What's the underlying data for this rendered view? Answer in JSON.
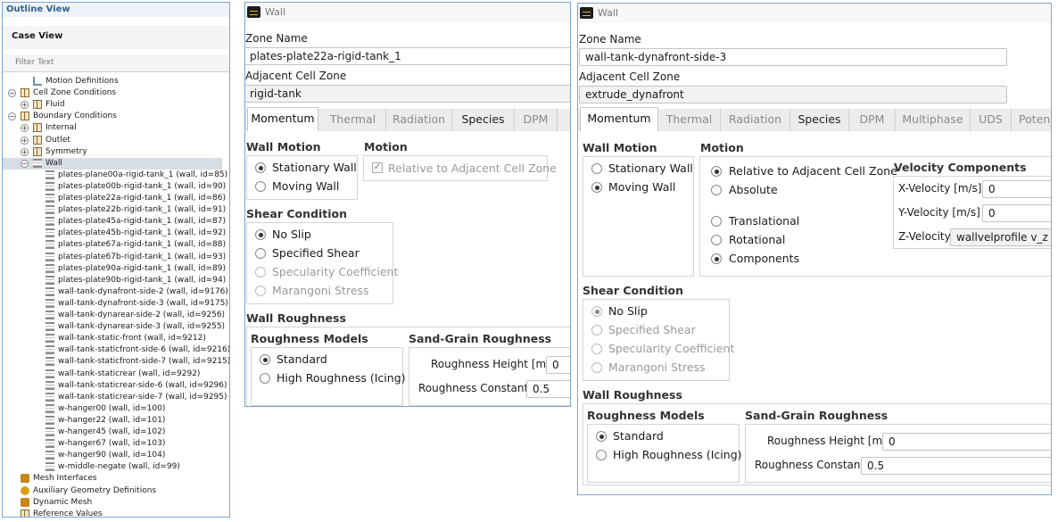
{
  "outline": {
    "title": "Outline View",
    "case_view": "Case View",
    "filter_placeholder": "Filter Text",
    "tree": [
      {
        "label": "Motion Definitions",
        "level": 2,
        "icon": "motion",
        "expander": ""
      },
      {
        "label": "Cell Zone Conditions",
        "level": 1,
        "icon": "grid",
        "expander": "−"
      },
      {
        "label": "Fluid",
        "level": 2,
        "icon": "grid",
        "expander": "+"
      },
      {
        "label": "Boundary Conditions",
        "level": 1,
        "icon": "grid",
        "expander": "−"
      },
      {
        "label": "Internal",
        "level": 2,
        "icon": "grid",
        "expander": "+"
      },
      {
        "label": "Outlet",
        "level": 2,
        "icon": "grid",
        "expander": "+"
      },
      {
        "label": "Symmetry",
        "level": 2,
        "icon": "grid",
        "expander": "+"
      },
      {
        "label": "Wall",
        "level": 2,
        "icon": "wall",
        "expander": "−",
        "selected": true
      },
      {
        "label": "plates-plane00a-rigid-tank_1 (wall, id=85)",
        "level": 3,
        "icon": "wall",
        "expander": ""
      },
      {
        "label": "plates-plate00b-rigid-tank_1 (wall, id=90)",
        "level": 3,
        "icon": "wall",
        "expander": ""
      },
      {
        "label": "plates-plate22a-rigid-tank_1 (wall, id=86)",
        "level": 3,
        "icon": "wall",
        "expander": ""
      },
      {
        "label": "plates-plate22b-rigid-tank_1 (wall, id=91)",
        "level": 3,
        "icon": "wall",
        "expander": ""
      },
      {
        "label": "plates-plate45a-rigid-tank_1 (wall, id=87)",
        "level": 3,
        "icon": "wall",
        "expander": ""
      },
      {
        "label": "plates-plate45b-rigid-tank_1 (wall, id=92)",
        "level": 3,
        "icon": "wall",
        "expander": ""
      },
      {
        "label": "plates-plate67a-rigid-tank_1 (wall, id=88)",
        "level": 3,
        "icon": "wall",
        "expander": ""
      },
      {
        "label": "plates-plate67b-rigid-tank_1 (wall, id=93)",
        "level": 3,
        "icon": "wall",
        "expander": ""
      },
      {
        "label": "plates-plate90a-rigid-tank_1 (wall, id=89)",
        "level": 3,
        "icon": "wall",
        "expander": ""
      },
      {
        "label": "plates-plate90b-rigid-tank_1 (wall, id=94)",
        "level": 3,
        "icon": "wall",
        "expander": ""
      },
      {
        "label": "wall-tank-dynafront-side-2 (wall, id=9176)",
        "level": 3,
        "icon": "wall",
        "expander": ""
      },
      {
        "label": "wall-tank-dynafront-side-3 (wall, id=9175)",
        "level": 3,
        "icon": "wall",
        "expander": ""
      },
      {
        "label": "wall-tank-dynarear-side-2 (wall, id=9256)",
        "level": 3,
        "icon": "wall",
        "expander": ""
      },
      {
        "label": "wall-tank-dynarear-side-3 (wall, id=9255)",
        "level": 3,
        "icon": "wall",
        "expander": ""
      },
      {
        "label": "wall-tank-static-front (wall, id=9212)",
        "level": 3,
        "icon": "wall",
        "expander": ""
      },
      {
        "label": "wall-tank-staticfront-side-6 (wall, id=9216)",
        "level": 3,
        "icon": "wall",
        "expander": ""
      },
      {
        "label": "wall-tank-staticfront-side-7 (wall, id=9215)",
        "level": 3,
        "icon": "wall",
        "expander": ""
      },
      {
        "label": "wall-tank-staticrear (wall, id=9292)",
        "level": 3,
        "icon": "wall",
        "expander": ""
      },
      {
        "label": "wall-tank-staticrear-side-6 (wall, id=9296)",
        "level": 3,
        "icon": "wall",
        "expander": ""
      },
      {
        "label": "wall-tank-staticrear-side-7 (wall, id=9295)",
        "level": 3,
        "icon": "wall",
        "expander": ""
      },
      {
        "label": "w-hanger00 (wall, id=100)",
        "level": 3,
        "icon": "wall",
        "expander": ""
      },
      {
        "label": "w-hanger22 (wall, id=101)",
        "level": 3,
        "icon": "wall",
        "expander": ""
      },
      {
        "label": "w-hanger45 (wall, id=102)",
        "level": 3,
        "icon": "wall",
        "expander": ""
      },
      {
        "label": "w-hanger67 (wall, id=103)",
        "level": 3,
        "icon": "wall",
        "expander": ""
      },
      {
        "label": "w-hanger90 (wall, id=104)",
        "level": 3,
        "icon": "wall",
        "expander": ""
      },
      {
        "label": "w-middle-negate (wall, id=99)",
        "level": 3,
        "icon": "wall",
        "expander": ""
      },
      {
        "label": "Mesh Interfaces",
        "level": 1,
        "icon": "orange",
        "expander": ""
      },
      {
        "label": "Auxiliary Geometry Definitions",
        "level": 1,
        "icon": "gear",
        "expander": ""
      },
      {
        "label": "Dynamic Mesh",
        "level": 1,
        "icon": "orange",
        "expander": ""
      },
      {
        "label": "Reference Values",
        "level": 1,
        "icon": "grid",
        "expander": ""
      }
    ]
  },
  "panel1": {
    "title": "Wall",
    "zone_name_label": "Zone Name",
    "zone_name": "plates-plate22a-rigid-tank_1",
    "adjacent_label": "Adjacent Cell Zone",
    "adjacent": "rigid-tank",
    "tabs": [
      "Momentum",
      "Thermal",
      "Radiation",
      "Species",
      "DPM",
      ""
    ],
    "wall_motion_title": "Wall Motion",
    "stationary": "Stationary Wall",
    "moving": "Moving Wall",
    "motion_title": "Motion",
    "relative": "Relative to Adjacent Cell Zone",
    "shear_title": "Shear Condition",
    "shear": [
      "No Slip",
      "Specified Shear",
      "Specularity Coefficient",
      "Marangoni Stress"
    ],
    "roughness_title": "Wall Roughness",
    "models_title": "Roughness Models",
    "standard": "Standard",
    "high": "High Roughness (Icing)",
    "sand_title": "Sand-Grain Roughness",
    "height_label": "Roughness Height [m]",
    "height_value": "0",
    "constant_label": "Roughness Constant",
    "constant_value": "0.5"
  },
  "panel2": {
    "title": "Wall",
    "zone_name_label": "Zone Name",
    "zone_name": "wall-tank-dynafront-side-3",
    "adjacent_label": "Adjacent Cell Zone",
    "adjacent": "extrude_dynafront",
    "tabs": [
      "Momentum",
      "Thermal",
      "Radiation",
      "Species",
      "DPM",
      "Multiphase",
      "UDS",
      "Poten"
    ],
    "wall_motion_title": "Wall Motion",
    "stationary": "Stationary Wall",
    "moving": "Moving Wall",
    "motion_title": "Motion",
    "relative": "Relative to Adjacent Cell Zone",
    "absolute": "Absolute",
    "translational": "Translational",
    "rotational": "Rotational",
    "components": "Components",
    "velocity_title": "Velocity Components",
    "xvel_label": "X-Velocity [m/s]",
    "xvel": "0",
    "yvel_label": "Y-Velocity [m/s]",
    "yvel": "0",
    "zvel_label": "Z-Velocity",
    "zvel": "wallvelprofile v_z",
    "shear_title": "Shear Condition",
    "shear": [
      "No Slip",
      "Specified Shear",
      "Specularity Coefficient",
      "Marangoni Stress"
    ],
    "roughness_title": "Wall Roughness",
    "models_title": "Roughness Models",
    "standard": "Standard",
    "high": "High Roughness (Icing)",
    "sand_title": "Sand-Grain Roughness",
    "height_label": "Roughness Height [m]",
    "height_value": "0",
    "constant_label": "Roughness Constant",
    "constant_value": "0.5"
  }
}
